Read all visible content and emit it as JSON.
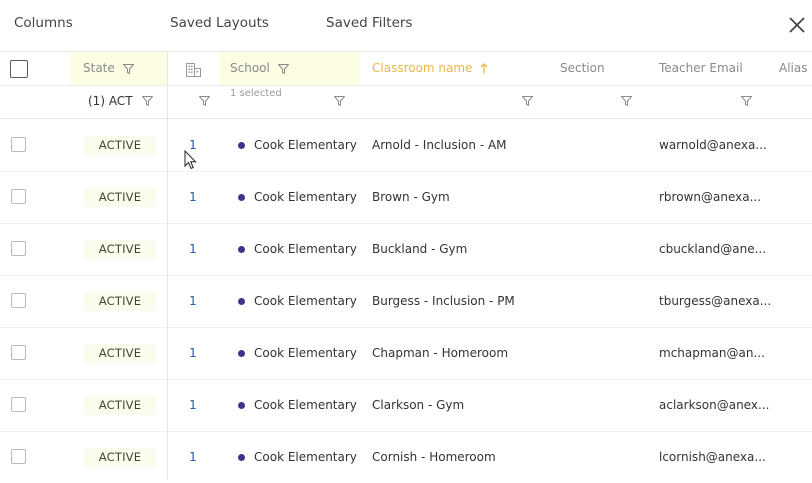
{
  "toolbar": {
    "columns": "Columns",
    "saved_layouts": "Saved Layouts",
    "saved_filters": "Saved Filters"
  },
  "icons": {
    "close": "close-icon",
    "filter": "funnel-icon",
    "building": "building-icon",
    "sort": "arrow-up-icon",
    "cursor": "mouse-pointer-icon"
  },
  "colors": {
    "highlight": "#fdfde4",
    "sorted_header": "#e9b94a",
    "school_dot": "#44318c",
    "count_link": "#2f5aa8"
  },
  "header": {
    "state": "State",
    "school": "School",
    "classroom_name": "Classroom name",
    "section": "Section",
    "teacher_email": "Teacher Email",
    "alias": "Alias o"
  },
  "filters": {
    "state": "(1) ACT",
    "school": "1 selected"
  },
  "rows": [
    {
      "state": "ACTIVE",
      "count": "1",
      "school": "Cook Elementary",
      "classroom": "Arnold - Inclusion - AM",
      "email": "warnold@anexa..."
    },
    {
      "state": "ACTIVE",
      "count": "1",
      "school": "Cook Elementary",
      "classroom": "Brown - Gym",
      "email": "rbrown@anexa..."
    },
    {
      "state": "ACTIVE",
      "count": "1",
      "school": "Cook Elementary",
      "classroom": "Buckland - Gym",
      "email": "cbuckland@ane..."
    },
    {
      "state": "ACTIVE",
      "count": "1",
      "school": "Cook Elementary",
      "classroom": "Burgess - Inclusion - PM",
      "email": "tburgess@anexa..."
    },
    {
      "state": "ACTIVE",
      "count": "1",
      "school": "Cook Elementary",
      "classroom": "Chapman - Homeroom",
      "email": "mchapman@an..."
    },
    {
      "state": "ACTIVE",
      "count": "1",
      "school": "Cook Elementary",
      "classroom": "Clarkson - Gym",
      "email": "aclarkson@anex..."
    },
    {
      "state": "ACTIVE",
      "count": "1",
      "school": "Cook Elementary",
      "classroom": "Cornish - Homeroom",
      "email": "lcornish@anexa..."
    }
  ]
}
